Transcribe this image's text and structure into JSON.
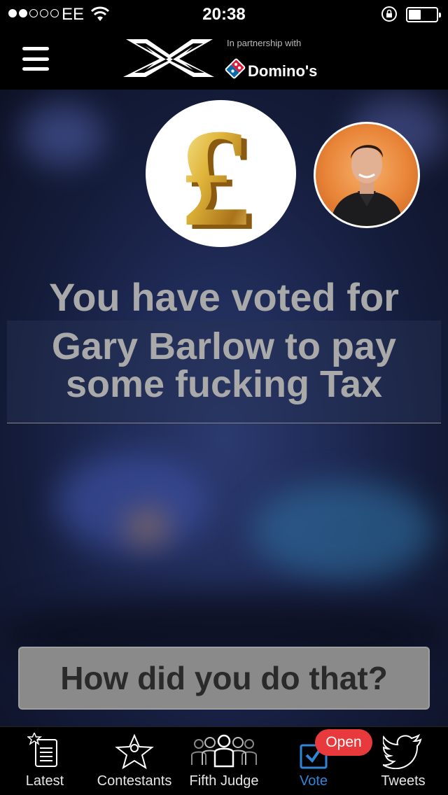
{
  "status_bar": {
    "carrier": "EE",
    "time": "20:38",
    "signal_bars_on": 2,
    "signal_bars_total": 5,
    "battery_level": 0.45
  },
  "header": {
    "menu_icon": "hamburger-menu-icon",
    "partnership_text": "In partnership with",
    "sponsor_name": "Domino's"
  },
  "vote": {
    "heading": "You have voted for",
    "choice_line1": "Gary Barlow to pay",
    "choice_line2": "some fucking Tax",
    "coin_icon": "pound-sign-icon",
    "how_button_label": "How did you do that?"
  },
  "tab_bar": {
    "tabs": [
      {
        "label": "Latest",
        "icon": "news-icon"
      },
      {
        "label": "Contestants",
        "icon": "star-person-icon"
      },
      {
        "label": "Fifth Judge",
        "icon": "crowd-icon"
      },
      {
        "label": "Vote",
        "icon": "checkbox-icon"
      },
      {
        "label": "Tweets",
        "icon": "twitter-bird-icon"
      }
    ],
    "active_tab": "Vote",
    "badge_text": "Open"
  },
  "colors": {
    "accent_blue": "#2f86d6",
    "badge_red": "#e8393d",
    "avatar_bg": "#e88438"
  }
}
